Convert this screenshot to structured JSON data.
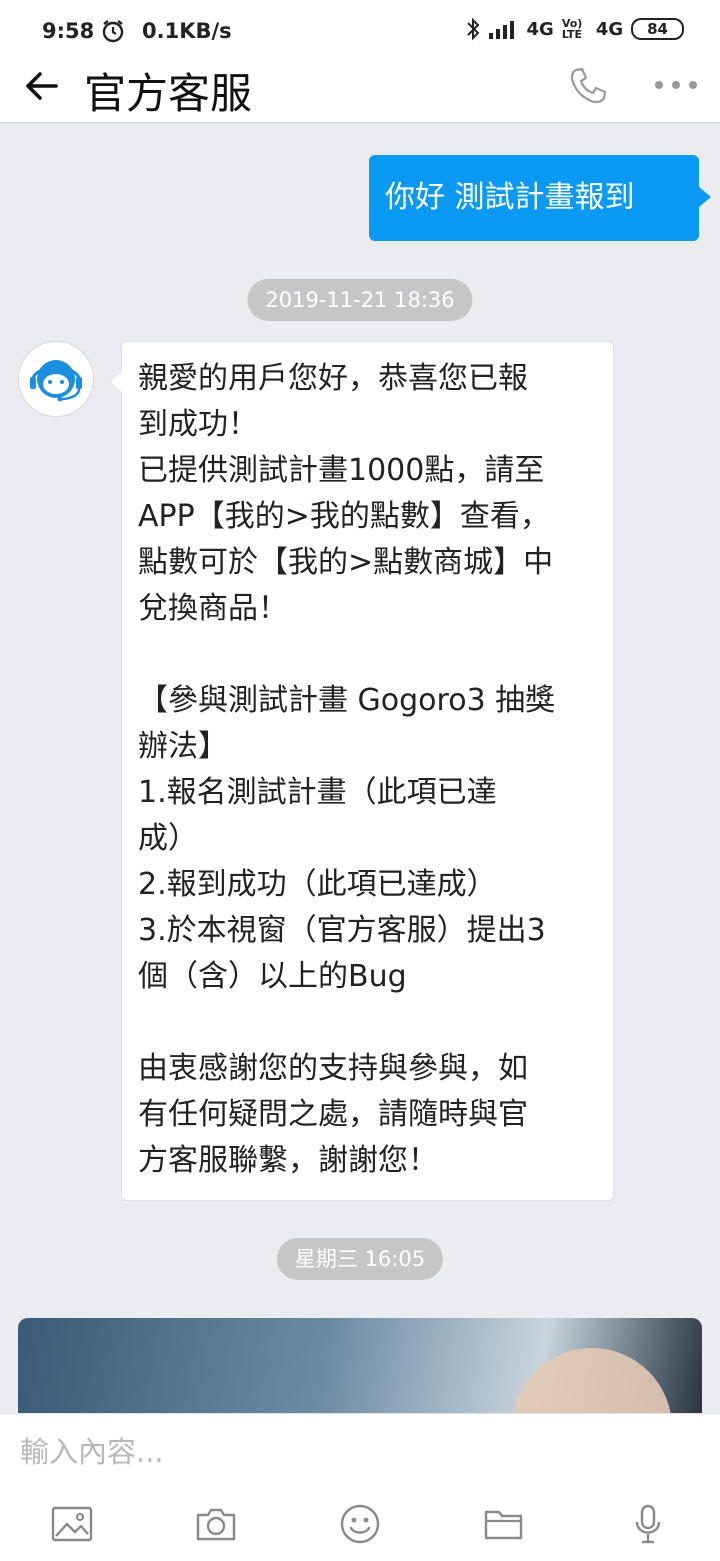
{
  "status_bar": {
    "time": "9:58",
    "network_speed": "0.1KB/s",
    "signal_1": "4G",
    "volte": "Vo) LTE",
    "signal_2": "4G",
    "battery": "84"
  },
  "header": {
    "title": "官方客服"
  },
  "messages": {
    "outgoing_1": "你好 測試計畫報到",
    "timestamp_1": "2019-11-21 18:36",
    "incoming_1_lines": [
      "親愛的用戶您好，恭喜您已報",
      "到成功！",
      "已提供測試計畫1000點，請至",
      "APP【我的>我的點數】查看，",
      "點數可於【我的>點數商城】中",
      "兌換商品！",
      "",
      "【參與測試計畫 Gogoro3 抽獎",
      "辦法】",
      "1.報名測試計畫（此項已達",
      "成）",
      "2.報到成功（此項已達成）",
      "3.於本視窗（官方客服）提出3",
      "個（含）以上的Bug",
      "",
      "由衷感謝您的支持與參與，如",
      "有任何疑問之處，請隨時與官",
      "方客服聯繫，謝謝您！"
    ],
    "timestamp_2": "星期三 16:05"
  },
  "input": {
    "placeholder": "輸入內容..."
  },
  "icons": {
    "back": "arrow-left-icon",
    "phone": "phone-icon",
    "more": "more-dots-icon",
    "gallery": "image-icon",
    "camera": "camera-icon",
    "emoji": "emoji-icon",
    "folder": "folder-icon",
    "mic": "microphone-icon"
  },
  "colors": {
    "accent": "#0a9af4",
    "background": "#ebecf0",
    "timestamp_pill": "#c6c6c8"
  }
}
